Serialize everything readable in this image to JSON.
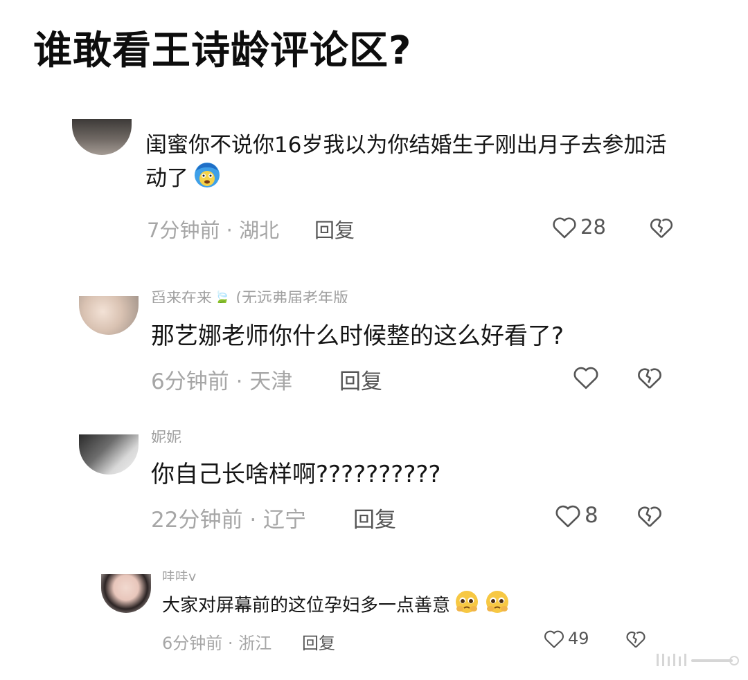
{
  "title": "谁敢看王诗龄评论区?",
  "comments": [
    {
      "username": "",
      "text": "闺蜜你不说你16岁我以为你结婚生子刚出月子去参加活动了",
      "time": "7分钟前",
      "location": "湖北",
      "reply_label": "回复",
      "likes": "28",
      "emoji": "cold-face-emoji"
    },
    {
      "username": "舀来在来🍃 (无远弗届老年版",
      "text": "那艺娜老师你什么时候整的这么好看了?",
      "time": "6分钟前",
      "location": "天津",
      "reply_label": "回复",
      "likes": ""
    },
    {
      "username": "妮妮",
      "text": "你自己长啥样啊??????????",
      "time": "22分钟前",
      "location": "辽宁",
      "reply_label": "回复",
      "likes": "8"
    },
    {
      "username": "哇哇y",
      "text": "大家对屏幕前的这位孕妇多一点善意",
      "time": "6分钟前",
      "location": "浙江",
      "reply_label": "回复",
      "likes": "49",
      "emoji": "pleading-face-emoji"
    }
  ],
  "separator": "·",
  "colors": {
    "background": "#ffffff",
    "text": "#151515",
    "meta": "#a6a6a6"
  }
}
